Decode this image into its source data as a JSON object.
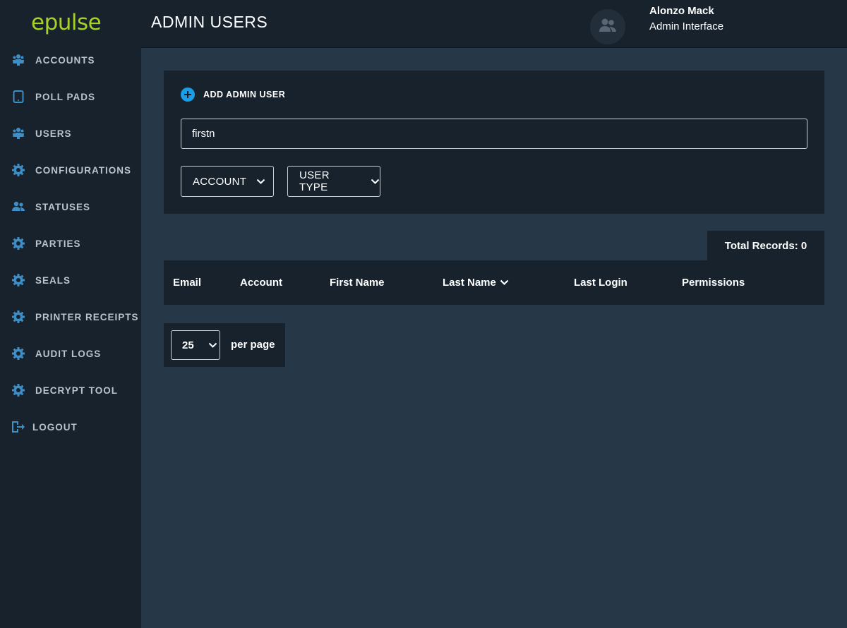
{
  "app": {
    "logo": "epulse"
  },
  "sidebar": {
    "items": [
      {
        "label": "ACCOUNTS",
        "icon": "group-icon"
      },
      {
        "label": "POLL PADS",
        "icon": "tablet-icon"
      },
      {
        "label": "USERS",
        "icon": "group-icon"
      },
      {
        "label": "CONFIGURATIONS",
        "icon": "gear-icon"
      },
      {
        "label": "STATUSES",
        "icon": "people-icon"
      },
      {
        "label": "PARTIES",
        "icon": "gear-icon"
      },
      {
        "label": "SEALS",
        "icon": "gear-icon"
      },
      {
        "label": "PRINTER RECEIPTS",
        "icon": "gear-icon"
      },
      {
        "label": "AUDIT LOGS",
        "icon": "gear-icon"
      },
      {
        "label": "DECRYPT TOOL",
        "icon": "gear-icon"
      },
      {
        "label": "LOGOUT",
        "icon": "logout-icon"
      }
    ]
  },
  "header": {
    "title": "ADMIN USERS",
    "user_name": "Alonzo Mack",
    "user_role": "Admin Interface"
  },
  "filters": {
    "add_label": "ADD ADMIN USER",
    "search_value": "firstn",
    "account_dropdown": "ACCOUNT",
    "user_type_dropdown": "USER TYPE"
  },
  "table": {
    "total_records": "Total Records: 0",
    "columns": [
      "Email",
      "Account",
      "First Name",
      "Last Name",
      "Last Login",
      "Permissions"
    ]
  },
  "pagination": {
    "page_size": "25",
    "per_page_label": "per page"
  },
  "colors": {
    "brand": "#a6d125",
    "accent": "#1a9ee8",
    "sidebar_bg": "#17222d",
    "main_bg": "#263847",
    "icon": "#3f8fc7"
  }
}
